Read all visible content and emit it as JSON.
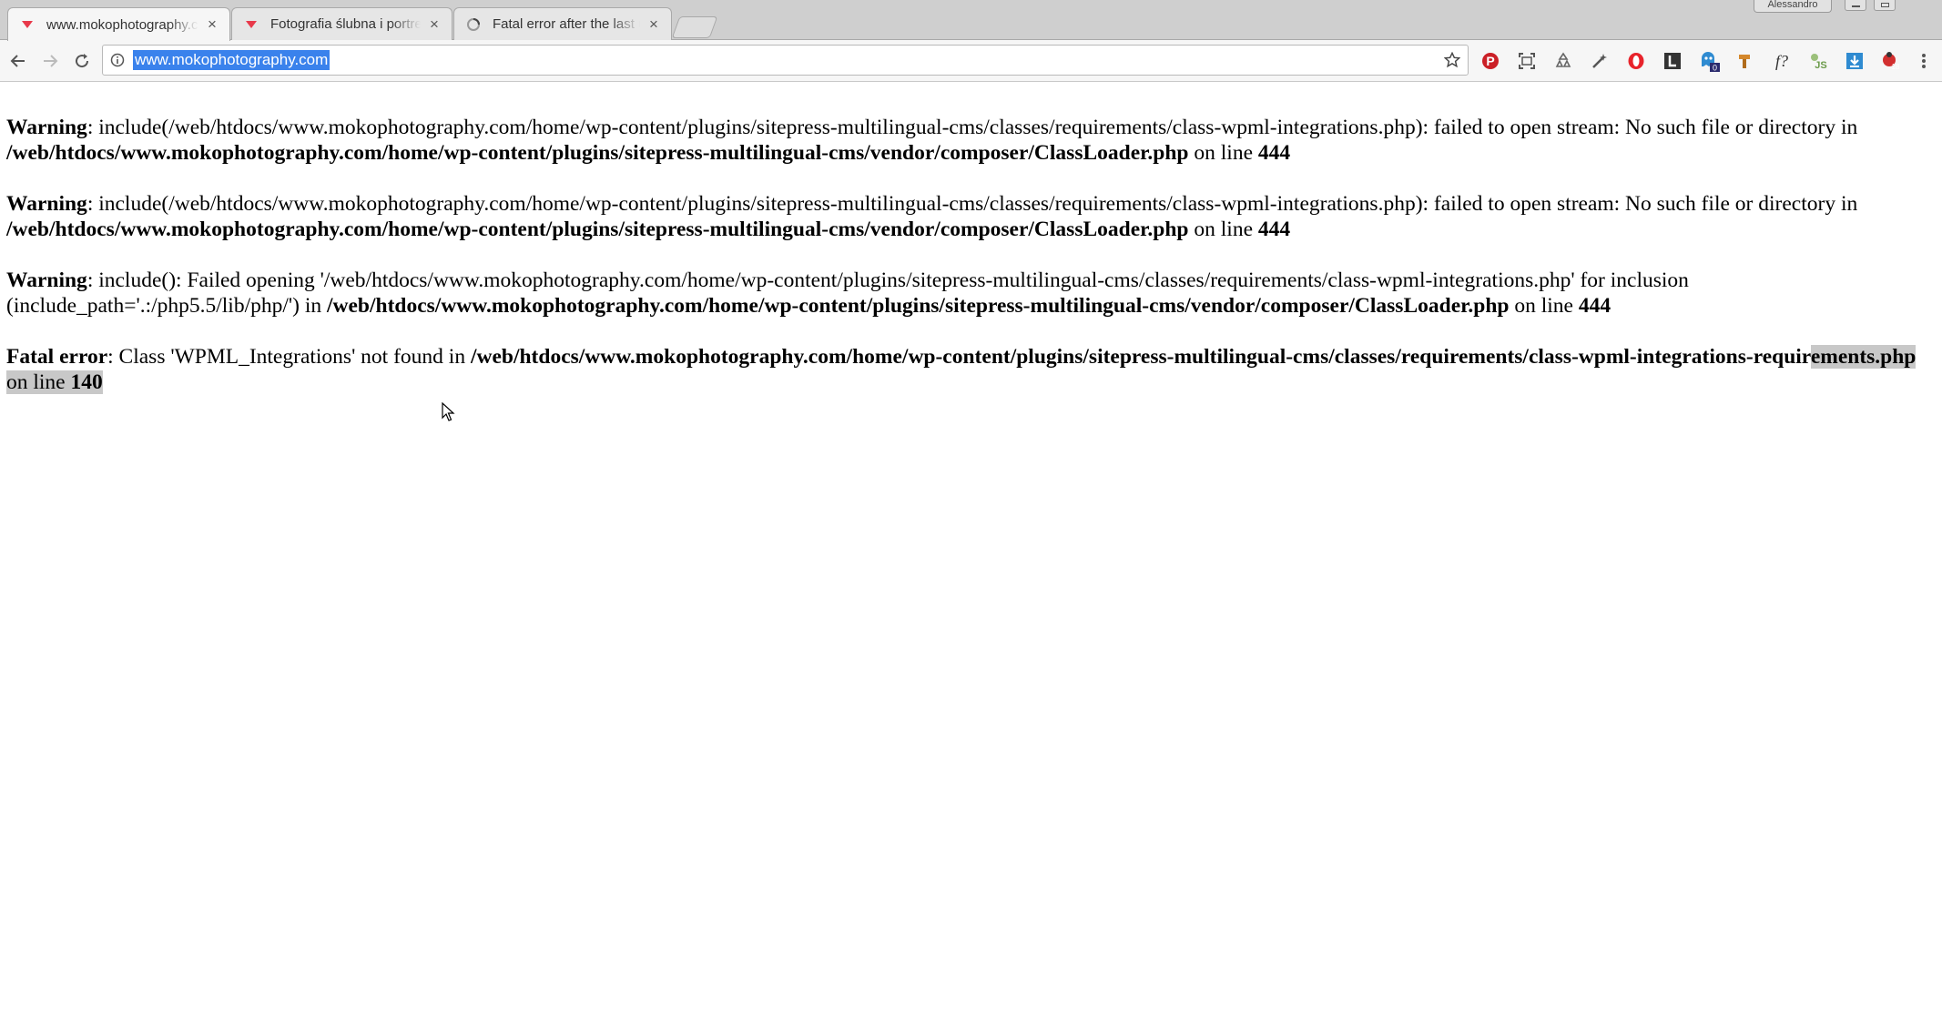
{
  "tabs": [
    {
      "title": "www.mokophotography.com",
      "close": "×",
      "active": true
    },
    {
      "title": "Fotografia ślubna i portretowa",
      "close": "×",
      "active": false
    },
    {
      "title": "Fatal error after the last update",
      "close": "×",
      "active": false
    }
  ],
  "profile": {
    "name": "Alessandro"
  },
  "address_bar": {
    "url": "www.mokophotography.com"
  },
  "extensions": [
    {
      "icon": "pinterest-icon",
      "color": "#cb2027"
    },
    {
      "icon": "screenshot-icon",
      "color": "#555555"
    },
    {
      "icon": "recycle-icon",
      "color": "#666666"
    },
    {
      "icon": "magic-wand-icon",
      "color": "#555555"
    },
    {
      "icon": "opera-icon",
      "color": "#e8232b"
    },
    {
      "icon": "lastpass-l-icon",
      "color": "#333333"
    },
    {
      "icon": "ghostery-icon",
      "color": "#2f8bd1",
      "badge": "0"
    },
    {
      "icon": "hammer-icon",
      "color": "#d4872b"
    },
    {
      "icon": "fonts-icon",
      "glyph": "f?",
      "color": "#333333"
    },
    {
      "icon": "javascript-toggle-icon",
      "glyph": "JS",
      "color": "#6b9b4a"
    },
    {
      "icon": "download-icon",
      "color": "#2f8bd1"
    },
    {
      "icon": "ladybug-icon",
      "color": "#d22f2f",
      "badge": "18"
    },
    {
      "icon": "menu-icon",
      "color": "#555555"
    }
  ],
  "errors": [
    {
      "label": "Warning",
      "text1": ": include(/web/htdocs/www.mokophotography.com/home/wp-content/plugins/sitepress-multilingual-cms/classes/requirements/class-wpml-integrations.php): failed to open stream: No such file or directory in ",
      "path": "/web/htdocs/www.mokophotography.com/home/wp-content/plugins/sitepress-multilingual-cms/vendor/composer/ClassLoader.php",
      "on_line": " on line ",
      "line": "444"
    },
    {
      "label": "Warning",
      "text1": ": include(/web/htdocs/www.mokophotography.com/home/wp-content/plugins/sitepress-multilingual-cms/classes/requirements/class-wpml-integrations.php): failed to open stream: No such file or directory in ",
      "path": "/web/htdocs/www.mokophotography.com/home/wp-content/plugins/sitepress-multilingual-cms/vendor/composer/ClassLoader.php",
      "on_line": " on line ",
      "line": "444"
    },
    {
      "label": "Warning",
      "text1": ": include(): Failed opening '/web/htdocs/www.mokophotography.com/home/wp-content/plugins/sitepress-multilingual-cms/classes/requirements/class-wpml-integrations.php' for inclusion (include_path='.:/php5.5/lib/php/') in ",
      "path": "/web/htdocs/www.mokophotography.com/home/wp-content/plugins/sitepress-multilingual-cms/vendor/composer/ClassLoader.php",
      "on_line": " on line ",
      "line": "444"
    }
  ],
  "fatal": {
    "label": "Fatal error",
    "text1": ": Class 'WPML_Integrations' not found in ",
    "path_part1": "/web/htdocs/www.mokophotography.com/home/wp-content/plugins/sitepress-multilingual-cms/classes/requirements/class-wpml-integrations-requir",
    "path_part2": "ements.php",
    "on_line": " on line ",
    "line": "140"
  }
}
